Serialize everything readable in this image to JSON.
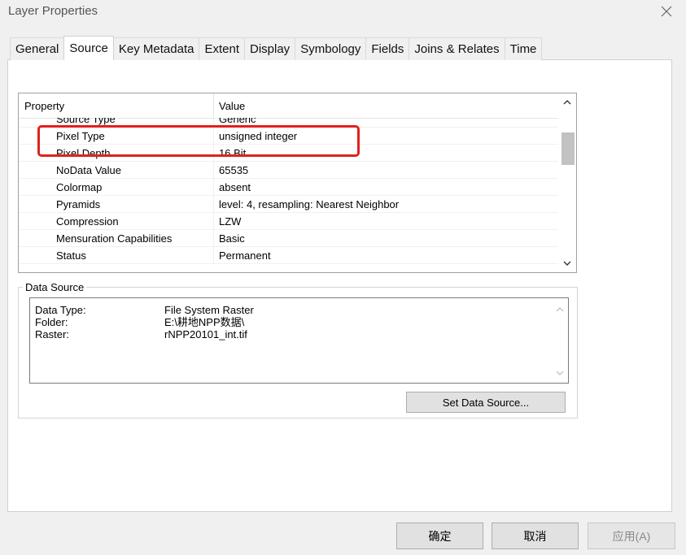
{
  "window": {
    "title": "Layer Properties",
    "close_icon": "close-icon"
  },
  "tabs": [
    {
      "label": "General",
      "active": false
    },
    {
      "label": "Source",
      "active": true
    },
    {
      "label": "Key Metadata",
      "active": false
    },
    {
      "label": "Extent",
      "active": false
    },
    {
      "label": "Display",
      "active": false
    },
    {
      "label": "Symbology",
      "active": false
    },
    {
      "label": "Fields",
      "active": false
    },
    {
      "label": "Joins & Relates",
      "active": false
    },
    {
      "label": "Time",
      "active": false
    }
  ],
  "properties": {
    "header": {
      "property": "Property",
      "value": "Value"
    },
    "rows": [
      {
        "name": "Source Type",
        "value": "Generic"
      },
      {
        "name": "Pixel Type",
        "value": "unsigned integer"
      },
      {
        "name": "Pixel Depth",
        "value": "16 Bit"
      },
      {
        "name": "NoData Value",
        "value": "65535"
      },
      {
        "name": "Colormap",
        "value": "absent"
      },
      {
        "name": "Pyramids",
        "value": "level: 4, resampling: Nearest Neighbor"
      },
      {
        "name": "Compression",
        "value": "LZW"
      },
      {
        "name": "Mensuration Capabilities",
        "value": "Basic"
      },
      {
        "name": "Status",
        "value": "Permanent"
      }
    ],
    "highlight_color": "#e02020"
  },
  "data_source": {
    "legend": "Data Source",
    "lines": [
      {
        "label": "Data Type:",
        "value": "File System Raster"
      },
      {
        "label": "Folder:",
        "value": "E:\\耕地NPP数据\\"
      },
      {
        "label": "Raster:",
        "value": "rNPP20101_int.tif"
      }
    ],
    "set_button": "Set Data Source..."
  },
  "buttons": {
    "ok": "确定",
    "cancel": "取消",
    "apply": "应用(A)"
  }
}
